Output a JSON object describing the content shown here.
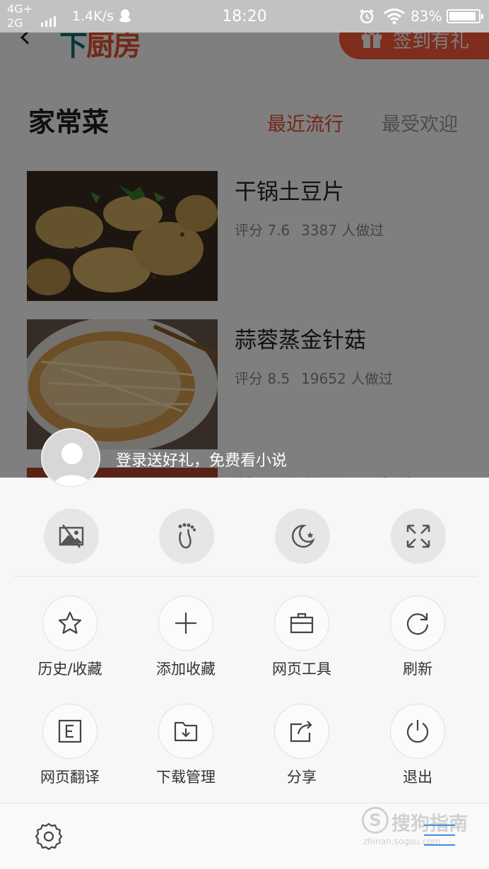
{
  "status_bar": {
    "network_top": "4G+",
    "network_bottom": "2G",
    "speed": "1.4K/s",
    "time": "18:20",
    "battery": "83%",
    "battery_level": 0.83
  },
  "page": {
    "logo_first": "下",
    "logo_rest": "厨房",
    "signin_label": "签到有礼",
    "section_title": "家常菜",
    "tabs": [
      {
        "label": "最近流行",
        "active": true
      },
      {
        "label": "最受欢迎",
        "active": false
      }
    ],
    "recipes": [
      {
        "name": "干锅土豆片",
        "score": "评分 7.6",
        "made": "3387 人做过"
      },
      {
        "name": "蒜蓉蒸金针菇",
        "score": "评分 8.5",
        "made": "19652 人做过"
      },
      {
        "name": "韩国泡菜饼儿(家庭"
      }
    ]
  },
  "login_prompt": "登录送好礼，免费看小说",
  "quick_actions": [
    {
      "icon": "no-image-icon"
    },
    {
      "icon": "footprint-icon"
    },
    {
      "icon": "night-mode-icon"
    },
    {
      "icon": "fullscreen-icon"
    }
  ],
  "menu_items": [
    {
      "label": "历史/收藏",
      "icon": "star-icon"
    },
    {
      "label": "添加收藏",
      "icon": "plus-icon"
    },
    {
      "label": "网页工具",
      "icon": "toolbox-icon"
    },
    {
      "label": "刷新",
      "icon": "refresh-icon"
    },
    {
      "label": "网页翻译",
      "icon": "translate-icon"
    },
    {
      "label": "下载管理",
      "icon": "download-folder-icon"
    },
    {
      "label": "分享",
      "icon": "share-icon"
    },
    {
      "label": "退出",
      "icon": "power-icon"
    }
  ],
  "watermark": {
    "text": "搜狗指南",
    "sub": "zhinan.sogou.com"
  },
  "colors": {
    "accent": "#ff5a38",
    "tab_active": "#e84a2e",
    "menu_toggle": "#3a8ee6",
    "overlay": "rgba(0,0,0,0.5)"
  }
}
